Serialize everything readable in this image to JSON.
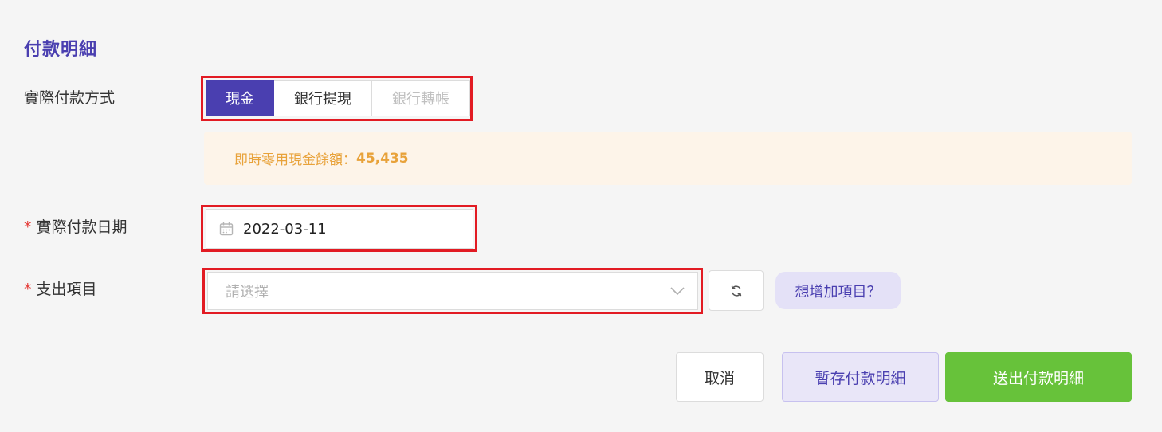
{
  "section": {
    "title": "付款明細"
  },
  "payment_method": {
    "label": "實際付款方式",
    "options": [
      {
        "label": "現金",
        "state": "active"
      },
      {
        "label": "銀行提現",
        "state": "normal"
      },
      {
        "label": "銀行轉帳",
        "state": "disabled"
      }
    ]
  },
  "balance_notice": {
    "prefix": "即時零用現金餘額：",
    "amount": "45,435"
  },
  "payment_date": {
    "required_mark": "*",
    "label": "實際付款日期",
    "value": "2022-03-11",
    "icon": "calendar-icon"
  },
  "expense_item": {
    "required_mark": "*",
    "label": "支出項目",
    "placeholder": "請選擇",
    "dropdown_icon": "chevron-down-icon",
    "refresh_icon": "refresh-icon",
    "add_item_label": "想增加項目？"
  },
  "footer": {
    "cancel_label": "取消",
    "draft_label": "暫存付款明細",
    "submit_label": "送出付款明細"
  },
  "colors": {
    "primary": "#4a3fb0",
    "success": "#67c23a",
    "warning_text": "#e8a23a",
    "warning_bg": "#fdf4e9",
    "required": "#e53935",
    "highlight_border": "#e21b23"
  }
}
